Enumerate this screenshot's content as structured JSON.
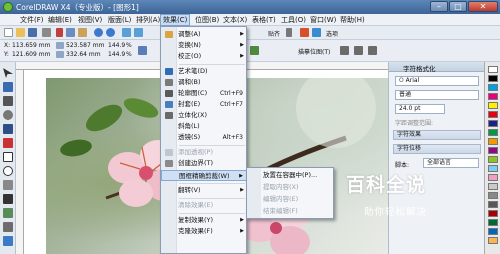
{
  "window": {
    "title": "CorelDRAW X4（专业版）- [图形1]"
  },
  "menubar": {
    "items": [
      {
        "label": "文件(F)"
      },
      {
        "label": "编辑(E)"
      },
      {
        "label": "视图(V)"
      },
      {
        "label": "版面(L)"
      },
      {
        "label": "排列(A)"
      },
      {
        "label": "效果(C)"
      },
      {
        "label": "位图(B)"
      },
      {
        "label": "文本(X)"
      },
      {
        "label": "表格(T)"
      },
      {
        "label": "工具(O)"
      },
      {
        "label": "窗口(W)"
      },
      {
        "label": "帮助(H)"
      }
    ],
    "active": "效果(C)"
  },
  "toolbar": {
    "zoom_label": "贴齐",
    "options_label": "选项",
    "bitmap_trace_label": "描摹位图(T)"
  },
  "propbar": {
    "x_value": "113.659 mm",
    "y_value": "121.609 mm",
    "width_value": "523.587 mm",
    "height_value": "332.64 mm",
    "scale_x": "144.9",
    "scale_y": "144.9",
    "percent": "%"
  },
  "effects_menu": {
    "items": [
      {
        "label": "调整(A)",
        "submenu": true
      },
      {
        "label": "变换(N)",
        "submenu": true
      },
      {
        "label": "校正(O)",
        "submenu": true
      },
      {
        "label": "艺术笔(D)"
      },
      {
        "label": "调和(B)"
      },
      {
        "label": "轮廓图(C)",
        "shortcut": "Ctrl+F9"
      },
      {
        "label": "封套(E)",
        "shortcut": "Ctrl+F7"
      },
      {
        "label": "立体化(X)"
      },
      {
        "label": "斜角(L)"
      },
      {
        "label": "透镜(S)",
        "shortcut": "Alt+F3"
      },
      {
        "label": "添加透视(P)",
        "disabled": true
      },
      {
        "label": "创建边界(T)"
      },
      {
        "label": "图框精确剪裁(W)",
        "submenu": true,
        "highlighted": true
      },
      {
        "label": "翻转(V)",
        "submenu": true
      },
      {
        "label": "清除效果(E)",
        "disabled": true
      },
      {
        "label": "复制效果(Y)",
        "submenu": true
      },
      {
        "label": "克隆效果(F)",
        "submenu": true
      }
    ]
  },
  "powerclip_submenu": {
    "items": [
      {
        "label": "放置在容器中(P)..."
      },
      {
        "label": "提取内容(X)",
        "disabled": true
      },
      {
        "label": "编辑内容(E)",
        "disabled": true
      },
      {
        "label": "结束编辑(F)",
        "disabled": true
      }
    ]
  },
  "docker": {
    "title": "字符格式化",
    "font_name": "Arial",
    "font_style": "普通",
    "font_size": "24.0 pt",
    "range_label": "字距调整范围:",
    "section_effects": "字符效果",
    "section_offset": "字符位移",
    "script_label": "脚本:",
    "script_value": "全部语言"
  },
  "watermark": {
    "title": "百科全说",
    "subtitle": "助你轻松解决"
  },
  "colors": {
    "accent_blue": "#3c6496",
    "menu_highlight": "#cfe0f5",
    "watermark_blue": "#1a8fd6"
  }
}
